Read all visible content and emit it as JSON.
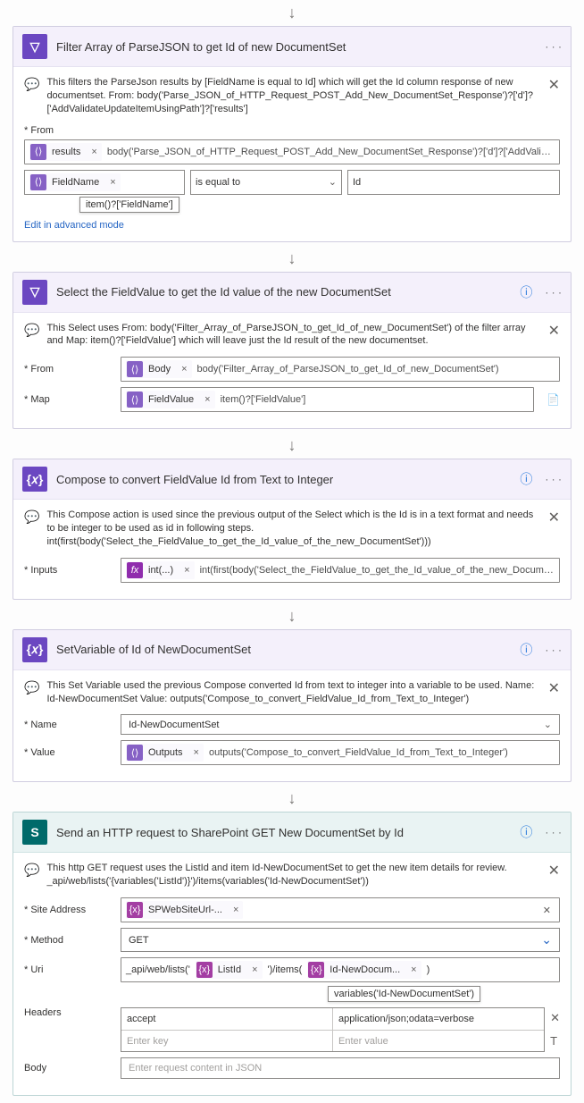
{
  "arrow": "↓",
  "ellipsis": "· · ·",
  "help": "ⓘ",
  "close": "✕",
  "chev": "⌄",
  "switch_icon": "⤢",
  "advanced_link": "Edit in advanced mode",
  "filter": {
    "title": "Filter Array of ParseJSON to get Id of new DocumentSet",
    "comment": "This filters the ParseJson results by [FieldName is equal to Id] which will get the Id column response of new documentset. From: body('Parse_JSON_of_HTTP_Request_POST_Add_New_DocumentSet_Response')?['d']?['AddValidateUpdateItemUsingPath']?['results']",
    "from_label": "From",
    "from_token": "results",
    "from_expr": "body('Parse_JSON_of_HTTP_Request_POST_Add_New_DocumentSet_Response')?['d']?['AddValidateUpdateItemUsingPath']?['results']",
    "cond_left_token": "FieldName",
    "cond_left_tooltip": "item()?['FieldName']",
    "cond_operator": "is equal to",
    "cond_right": "Id"
  },
  "select": {
    "title": "Select the FieldValue to get the Id value of the new DocumentSet",
    "comment": "This Select uses From: body('Filter_Array_of_ParseJSON_to_get_Id_of_new_DocumentSet') of the filter array and Map: item()?['FieldValue'] which will leave just the Id result of the new documentset.",
    "from_label": "From",
    "from_token": "Body",
    "from_expr": "body('Filter_Array_of_ParseJSON_to_get_Id_of_new_DocumentSet')",
    "map_label": "Map",
    "map_token": "FieldValue",
    "map_expr": "item()?['FieldValue']"
  },
  "compose": {
    "title": "Compose to convert FieldValue Id from Text to Integer",
    "comment": "This Compose action is used since the previous output of the Select which is the Id is in a text format and needs to be integer to be used as id in following steps. int(first(body('Select_the_FieldValue_to_get_the_Id_value_of_the_new_DocumentSet')))",
    "inputs_label": "Inputs",
    "inputs_token": "int(...)",
    "inputs_expr": "int(first(body('Select_the_FieldValue_to_get_the_Id_value_of_the_new_DocumentSet')))"
  },
  "setvar": {
    "title": "SetVariable of Id of NewDocumentSet",
    "comment": "This Set Variable used the previous Compose converted Id from text to integer into a variable to be used. Name: Id-NewDocumentSet Value: outputs('Compose_to_convert_FieldValue_Id_from_Text_to_Integer')",
    "name_label": "Name",
    "name_value": "Id-NewDocumentSet",
    "value_label": "Value",
    "value_token": "Outputs",
    "value_expr": "outputs('Compose_to_convert_FieldValue_Id_from_Text_to_Integer')"
  },
  "http": {
    "title": "Send an HTTP request to SharePoint GET New DocumentSet by Id",
    "comment": "This http GET request uses the ListId and item Id-NewDocumentSet to get the new item details for review. _api/web/lists('{variables('ListId')}')/items(variables('Id-NewDocumentSet'))",
    "site_label": "Site Address",
    "site_token": "SPWebSiteUrl-...",
    "method_label": "Method",
    "method_value": "GET",
    "uri_label": "Uri",
    "uri_prefix": "_api/web/lists('",
    "uri_token1": "ListId",
    "uri_mid": "')/items(",
    "uri_token2": "Id-NewDocum...",
    "uri_suffix": ")",
    "uri_tooltip": "variables('Id-NewDocumentSet')",
    "headers_label": "Headers",
    "hdr_key": "accept",
    "hdr_val": "application/json;odata=verbose",
    "hdr_key_ph": "Enter key",
    "hdr_val_ph": "Enter value",
    "body_label": "Body",
    "body_ph": "Enter request content in JSON"
  }
}
